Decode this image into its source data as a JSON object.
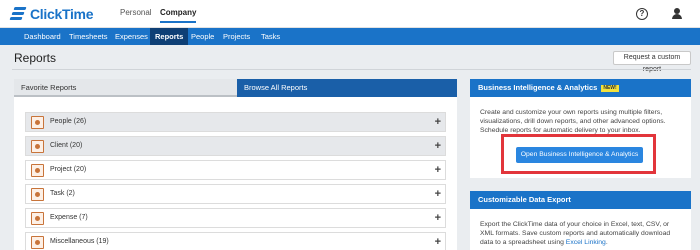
{
  "app": {
    "logo": "ClickTime"
  },
  "topbar": {
    "personal": "Personal",
    "company": "Company",
    "help_glyph": "?"
  },
  "nav": {
    "items": [
      "Dashboard",
      "Timesheets",
      "Expenses",
      "Reports",
      "People",
      "Projects",
      "Tasks"
    ],
    "active": "Reports"
  },
  "page": {
    "title": "Reports",
    "request_button": "Request a custom report"
  },
  "tabs": {
    "favorite": "Favorite Reports",
    "browse": "Browse All Reports"
  },
  "categories": [
    {
      "label": "People (26)",
      "icon": "people-report-icon"
    },
    {
      "label": "Client (20)",
      "icon": "client-handshake-icon"
    },
    {
      "label": "Project (20)",
      "icon": "project-pie-icon"
    },
    {
      "label": "Task (2)",
      "icon": "task-check-icon"
    },
    {
      "label": "Expense (7)",
      "icon": "expense-dollar-icon"
    },
    {
      "label": "Miscellaneous (19)",
      "icon": "misc-chart-icon"
    }
  ],
  "bi_panel": {
    "title": "Business Intelligence & Analytics",
    "badge": "NEW!",
    "description": "Create and customize your own reports using multiple filters, visualizations, drill down reports, and other advanced options. Schedule reports for automatic delivery to your inbox.",
    "button": "Open Business Intelligence & Analytics"
  },
  "export_panel": {
    "title": "Customizable Data Export",
    "description_pre": "Export the ClickTime data of your choice in Excel, text, CSV, or XML formats. Save custom reports and automatically download data to a spreadsheet using ",
    "link": "Excel Linking",
    "description_post": "."
  },
  "colors": {
    "brand": "#1a73c8",
    "nav_active": "#0e3f75",
    "highlight": "#e2353b",
    "badge": "#f3e13c"
  }
}
